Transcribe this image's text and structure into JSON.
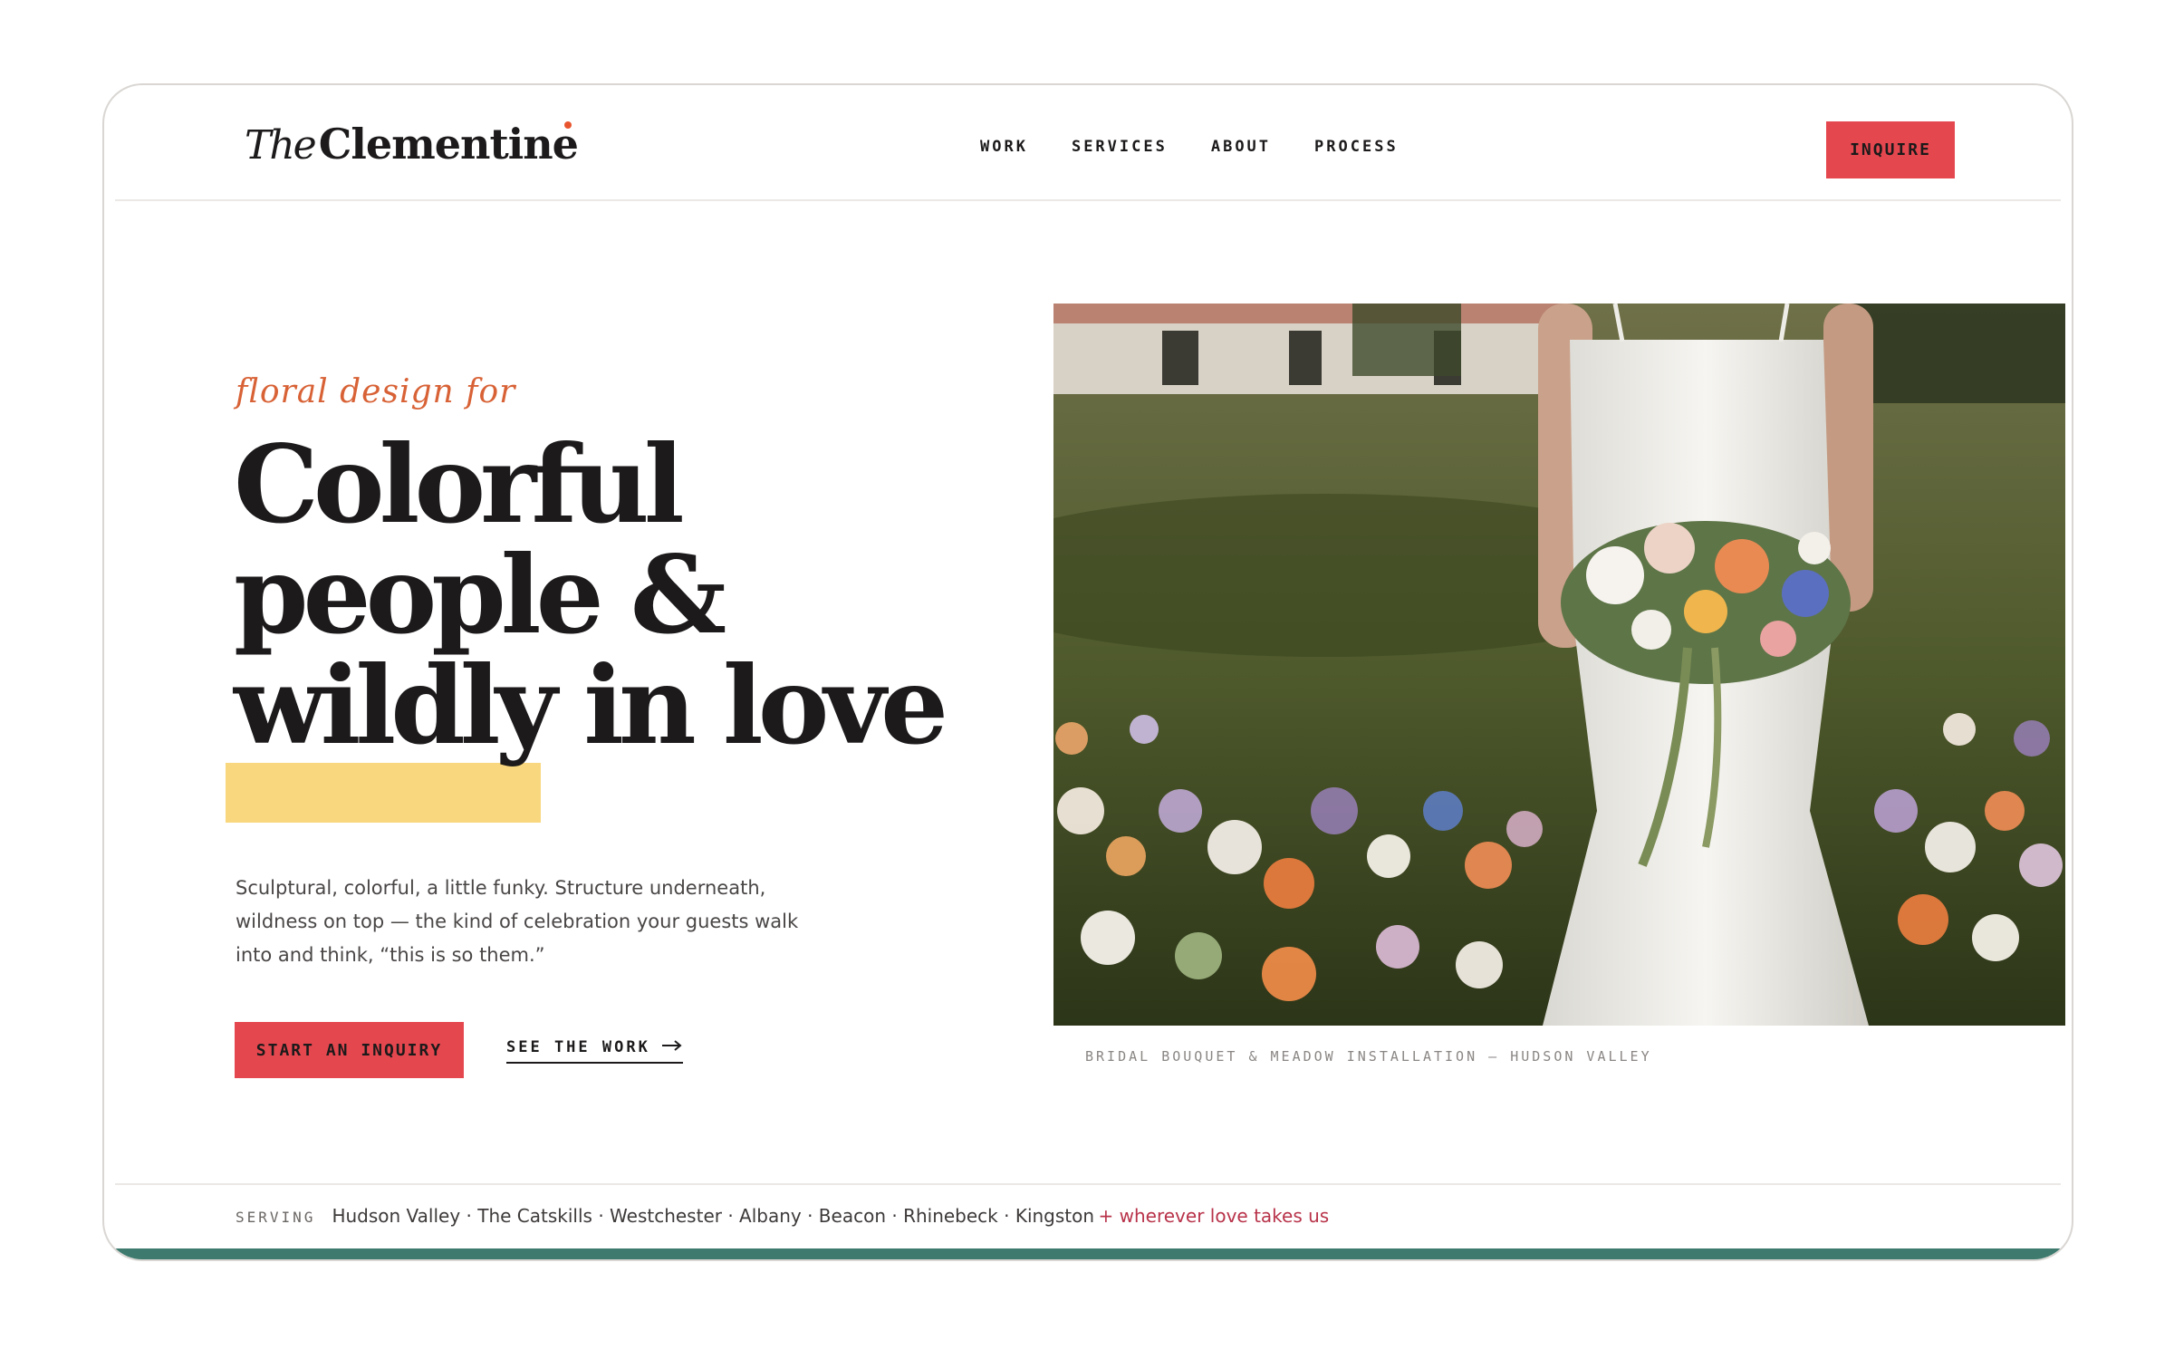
{
  "header": {
    "logo_script": "The",
    "logo_name": "Clementine",
    "nav": [
      "WORK",
      "SERVICES",
      "ABOUT",
      "PROCESS"
    ],
    "inquire_label": "INQUIRE"
  },
  "hero": {
    "kicker": "floral design for",
    "headline_line1": "Colorful",
    "headline_line2": "people &",
    "headline_highlight": "wildly",
    "headline_line3_rest": " in love",
    "body_line1": "Sculptural, colorful, a little funky. Structure underneath,",
    "body_line2": "wildness on top — the kind of celebration your guests walk",
    "body_line3": "into and think, “this is so them.”",
    "cta_primary": "START AN INQUIRY",
    "cta_secondary": "SEE THE WORK",
    "cta_secondary_icon": "arrow-right-icon"
  },
  "photo": {
    "caption": "BRIDAL BOUQUET & MEADOW INSTALLATION — HUDSON VALLEY"
  },
  "serving": {
    "label": "SERVING",
    "places": "Hudson Valley · The Catskills · Westchester · Albany · Beacon · Rhinebeck · Kingston",
    "extra": "+ wherever love takes us"
  },
  "colors": {
    "accent_red": "#e5474f",
    "accent_orange": "#d86236",
    "highlight_yellow": "#f8d77e",
    "footer_teal": "#3e7a6e",
    "serving_extra": "#b8334a"
  }
}
